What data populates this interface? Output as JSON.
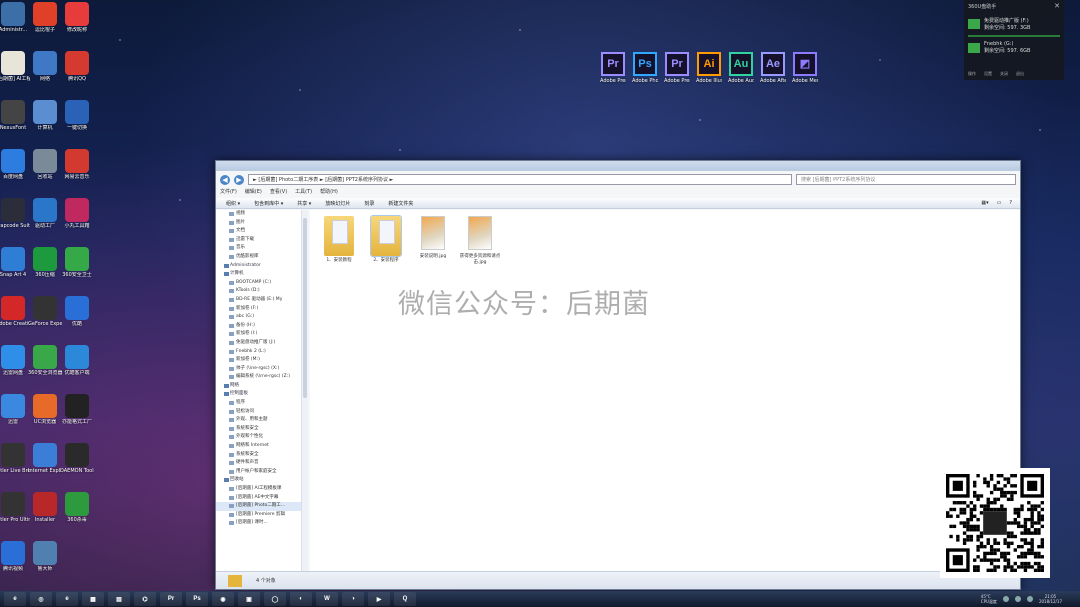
{
  "desktop_icons": [
    {
      "label": "Administr...",
      "color": "#3c6ea8"
    },
    {
      "label": "逗比棍子",
      "color": "#e04028"
    },
    {
      "label": "修改昵称",
      "color": "#e83c3c"
    },
    {
      "label": "[后期菌]\nAI工程...",
      "color": "#e8e4d8"
    },
    {
      "label": "网络",
      "color": "#3f79c5"
    },
    {
      "label": "腾讯QQ",
      "color": "#d43a30"
    },
    {
      "label": "NexusFont",
      "color": "#444"
    },
    {
      "label": "计算机",
      "color": "#5a8ed0"
    },
    {
      "label": "一键切换",
      "color": "#2a62b8"
    },
    {
      "label": "百度网盘",
      "color": "#2d7de0"
    },
    {
      "label": "回收站",
      "color": "#7a8a99"
    },
    {
      "label": "网易云音乐",
      "color": "#d23a30"
    },
    {
      "label": "Trapcode Suite 12.1...",
      "color": "#2b2d3a"
    },
    {
      "label": "驱动工厂",
      "color": "#2a76c8"
    },
    {
      "label": "小丸工具箱",
      "color": "#c02860"
    },
    {
      "label": "Snap Art 4",
      "color": "#2e7ed6"
    },
    {
      "label": "360压缩",
      "color": "#1e9a3e"
    },
    {
      "label": "360安全卫士",
      "color": "#35a848"
    },
    {
      "label": "Adobe Creati...",
      "color": "#d42828"
    },
    {
      "label": "GeForce Experience",
      "color": "#333"
    },
    {
      "label": "优酷",
      "color": "#2a6ed8"
    },
    {
      "label": "迅雷网盘",
      "color": "#2f8ee8"
    },
    {
      "label": "360安全浏览器",
      "color": "#38a848"
    },
    {
      "label": "优酷客户端",
      "color": "#2c88d8"
    },
    {
      "label": "迅雷",
      "color": "#3a88e0"
    },
    {
      "label": "UC浏览器",
      "color": "#e86a28"
    },
    {
      "label": "亦能格式工厂",
      "color": "#222"
    },
    {
      "label": "Titler Live Broadcast",
      "color": "#333"
    },
    {
      "label": "Internet Explorer",
      "color": "#3a7ed8"
    },
    {
      "label": "DAEMON Tools Lite",
      "color": "#2a2a2a"
    },
    {
      "label": "Titler Pro Ultimate",
      "color": "#333"
    },
    {
      "label": "Installer",
      "color": "#b82828"
    },
    {
      "label": "360杀毒",
      "color": "#2e9a3e"
    },
    {
      "label": "腾讯视频",
      "color": "#2a6ed8"
    },
    {
      "label": "鲁大师",
      "color": "#5080b0"
    }
  ],
  "adobe_apps": [
    {
      "abbr": "Pr",
      "label": "Adobe Premiere ...",
      "color": "#9b8cff"
    },
    {
      "abbr": "Ps",
      "label": "Adobe Photosh...",
      "color": "#31a8ff"
    },
    {
      "abbr": "Pr",
      "label": "Adobe Premiere ...",
      "color": "#9b8cff"
    },
    {
      "abbr": "Ai",
      "label": "Adobe Illustrato...",
      "color": "#ff9a00"
    },
    {
      "abbr": "Au",
      "label": "Adobe Auditi...",
      "color": "#2fd2a0"
    },
    {
      "abbr": "Ae",
      "label": "Adobe After Effects CC ...",
      "color": "#9999ff"
    },
    {
      "abbr": "",
      "label": "Adobe Media Enc...",
      "color": "#8d7bff"
    }
  ],
  "widget": {
    "title": "360U盘助手",
    "drive1_name": "免费驱动推广版 (F:)",
    "drive1_space": "剩余空间: 597. 3GB",
    "drive2_name": "Fnebhk (G:)",
    "drive2_space": "剩余空间: 597. 6GB",
    "footer": [
      "操作",
      "设置",
      "关闭",
      "退出"
    ]
  },
  "explorer": {
    "address": "► [后期菌] Photo二期工序表 ► [后期菌] PPT2系统序列协议 ►",
    "search_placeholder": "搜索 [后期菌] PPT2系统序列协议",
    "menu": [
      "文件(F)",
      "编辑(E)",
      "查看(V)",
      "工具(T)",
      "帮助(H)"
    ],
    "toolbar": [
      "组织 ▾",
      "包含到库中 ▾",
      "共享 ▾",
      "放映幻灯片",
      "刻录",
      "新建文件夹"
    ],
    "nav_items": [
      {
        "label": "视频",
        "type": "item"
      },
      {
        "label": "图片",
        "type": "item"
      },
      {
        "label": "文档",
        "type": "item"
      },
      {
        "label": "迅雷下载",
        "type": "item"
      },
      {
        "label": "音乐",
        "type": "item"
      },
      {
        "label": "优酷影视库",
        "type": "item"
      },
      {
        "label": "Administrator",
        "type": "hdr"
      },
      {
        "label": "计算机",
        "type": "hdr"
      },
      {
        "label": "BOOTCAMP (C:)",
        "type": "item"
      },
      {
        "label": "KTools (D:)",
        "type": "item"
      },
      {
        "label": "BD-RE 驱动器 (E:) My",
        "type": "item"
      },
      {
        "label": "新加卷 (F:)",
        "type": "item"
      },
      {
        "label": "abc (G:)",
        "type": "item"
      },
      {
        "label": "备份 (H:)",
        "type": "item"
      },
      {
        "label": "新加卷 (I:)",
        "type": "item"
      },
      {
        "label": "免驱盘动推广版 (J:)",
        "type": "item"
      },
      {
        "label": "Fnebhk 2 (L:)",
        "type": "item"
      },
      {
        "label": "新加卷 (M:)",
        "type": "item"
      },
      {
        "label": "帅子 (\\\\ne-rgsc) (X:)",
        "type": "item"
      },
      {
        "label": "编辑系统 (\\\\rne-rgsc) (Z:)",
        "type": "item"
      },
      {
        "label": "网络",
        "type": "hdr"
      },
      {
        "label": "控制面板",
        "type": "hdr"
      },
      {
        "label": "程序",
        "type": "item"
      },
      {
        "label": "轻松访问",
        "type": "item"
      },
      {
        "label": "外观、用和主题",
        "type": "item"
      },
      {
        "label": "系统和安全",
        "type": "item"
      },
      {
        "label": "外观和个性化",
        "type": "item"
      },
      {
        "label": "网络和 Internet",
        "type": "item"
      },
      {
        "label": "系统和安全",
        "type": "item"
      },
      {
        "label": "硬件和声音",
        "type": "item"
      },
      {
        "label": "用户帐户和家庭安全",
        "type": "item"
      },
      {
        "label": "回收站",
        "type": "hdr"
      },
      {
        "label": "[后期菌] AI工程模板课",
        "type": "item"
      },
      {
        "label": "[后期菌] AE中文字幕",
        "type": "item"
      },
      {
        "label": "[后期菌] Photo二期工...",
        "type": "item",
        "selected": true
      },
      {
        "label": "[后期菌] Premiere 剪辑",
        "type": "item"
      },
      {
        "label": "[后期菌] 课时...",
        "type": "item"
      }
    ],
    "files": [
      {
        "label": "1、安装教程",
        "kind": "folder"
      },
      {
        "label": "2、安装程序",
        "kind": "folder",
        "selected": true
      },
      {
        "label": "安装说明.jpg",
        "kind": "image"
      },
      {
        "label": "获得更多资源和请点击.jpg",
        "kind": "image"
      }
    ],
    "status": "4 个对象"
  },
  "watermark": "微信公众号：后期菌",
  "taskbar": {
    "apps": [
      "e",
      "◎",
      "e",
      "▦",
      "▤",
      "⌬",
      "Pr",
      "Ps",
      "◉",
      "▣",
      "◯",
      "◐",
      "W",
      "◑",
      "▶",
      "Q"
    ],
    "tray_temp": "45°C",
    "tray_cpu": "CPU温度",
    "time": "21:05",
    "date": "2018/12/17"
  }
}
